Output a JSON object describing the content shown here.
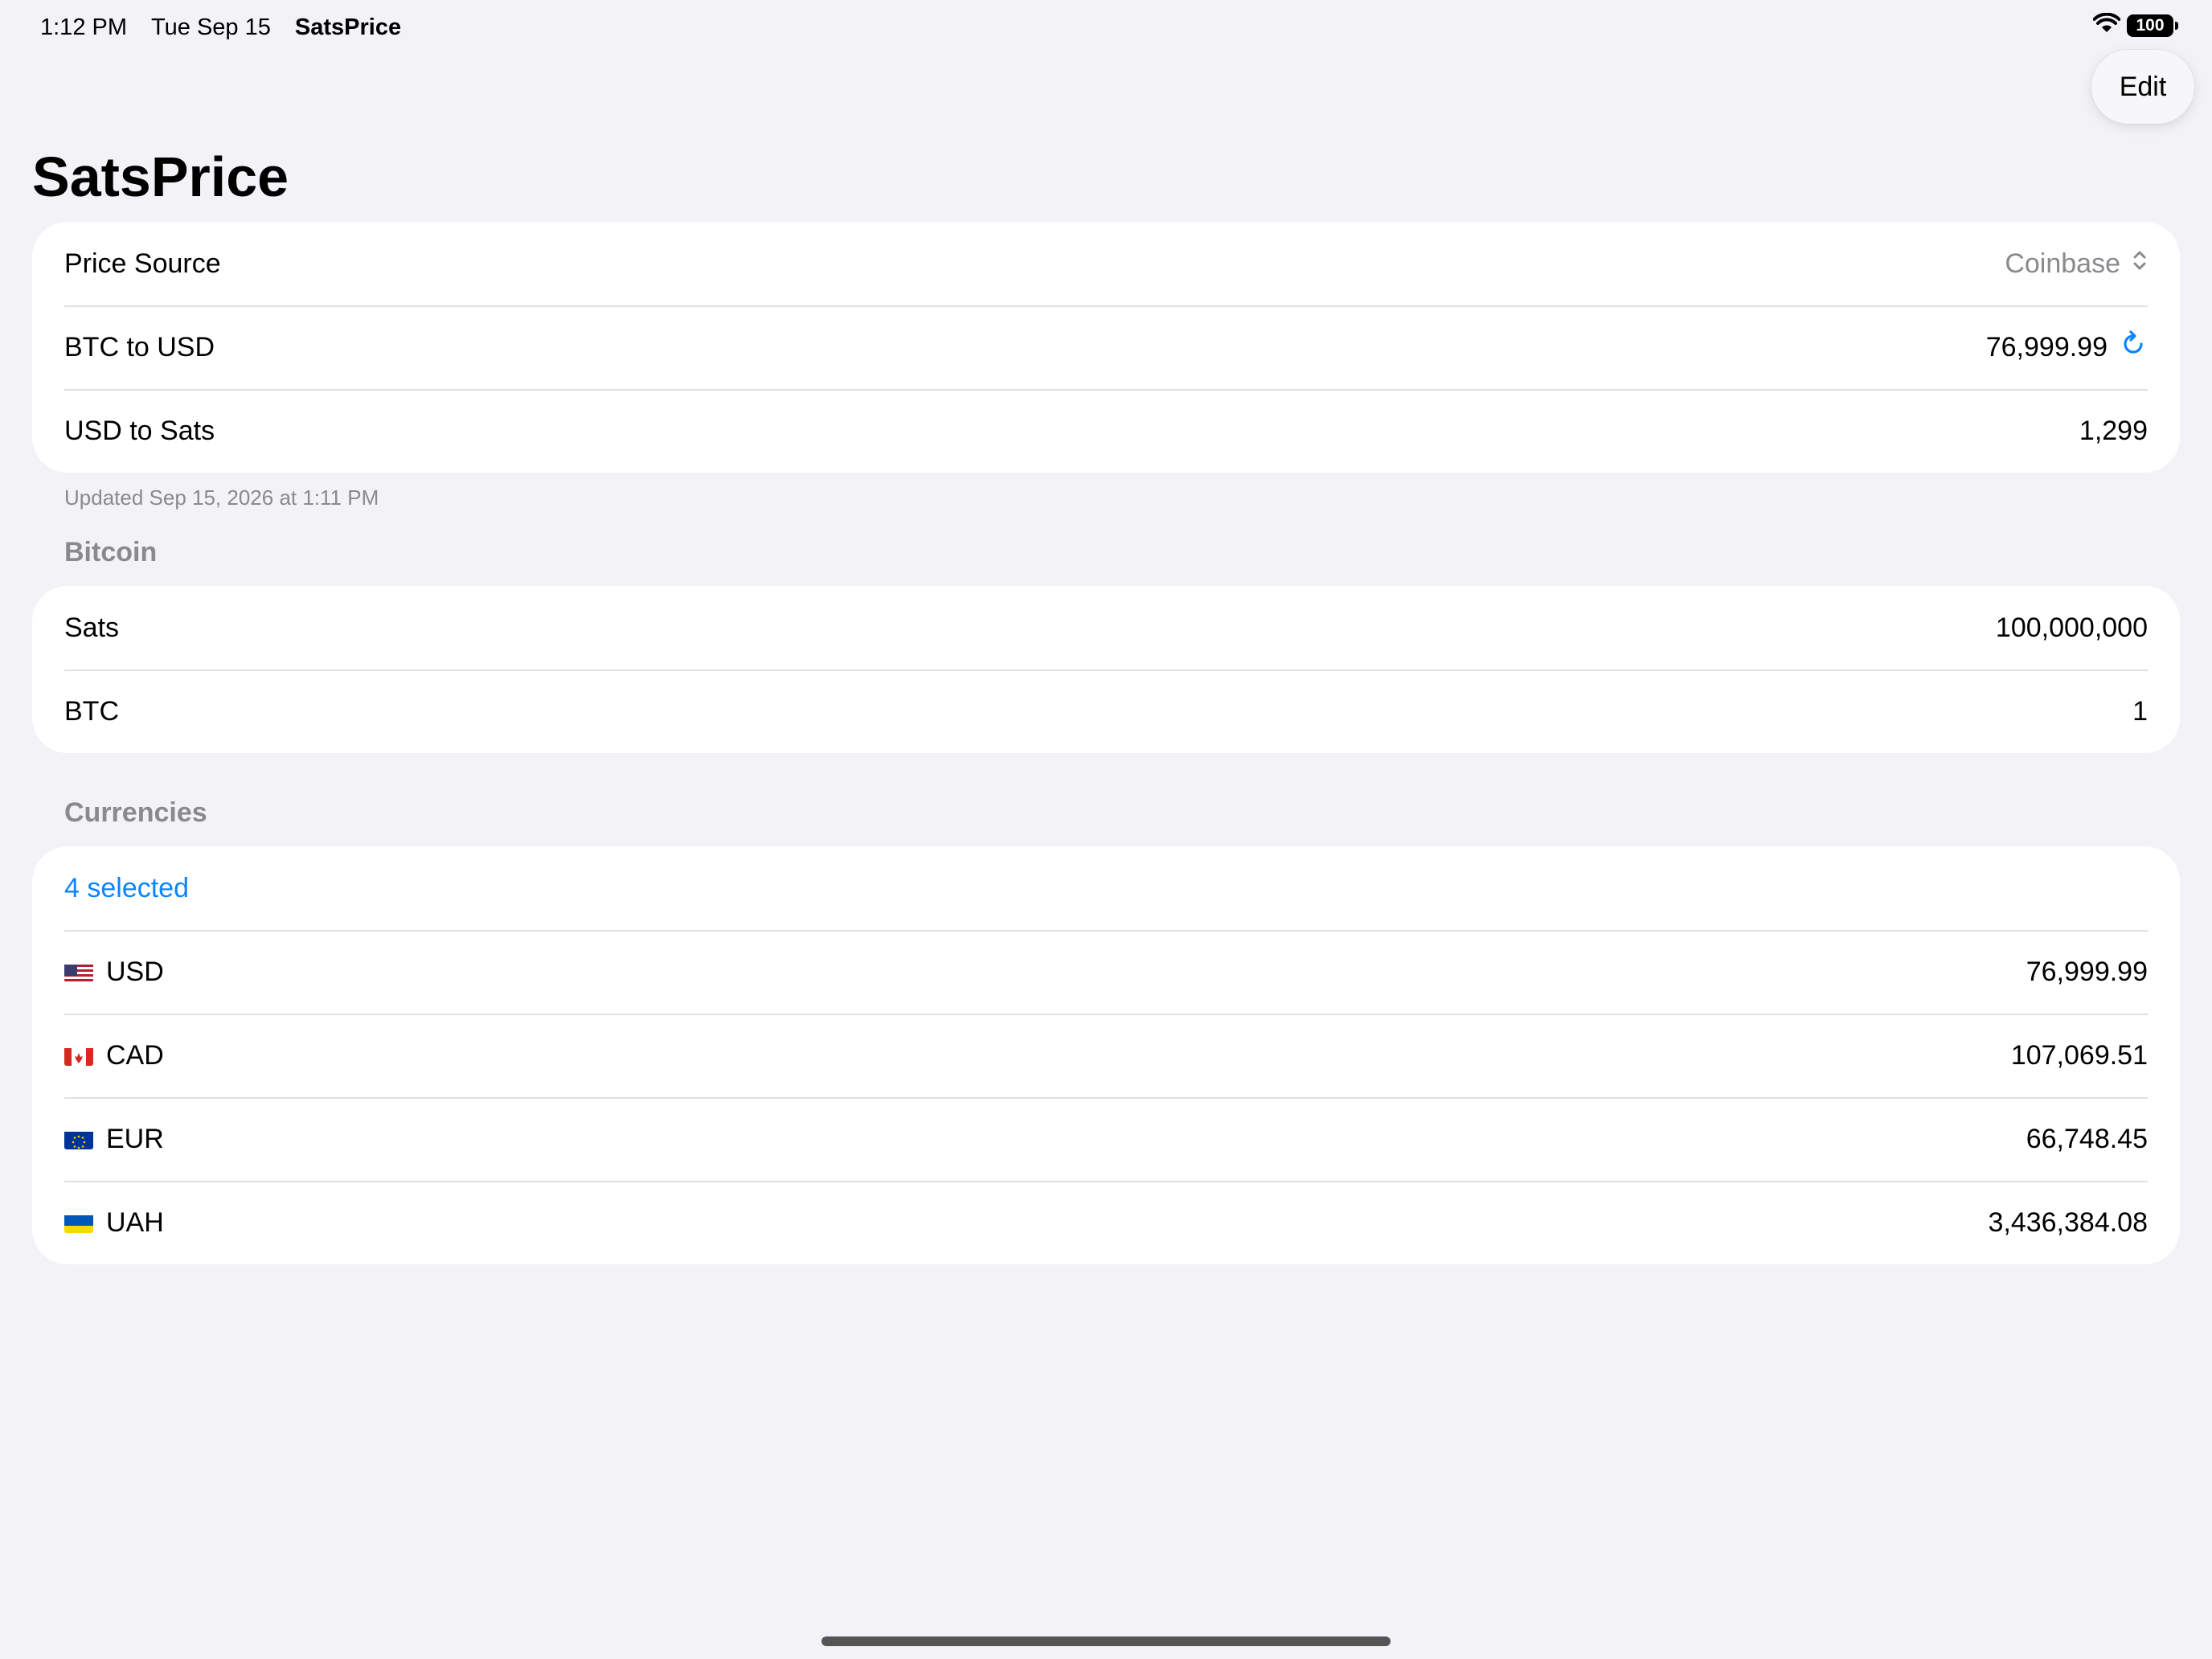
{
  "status_bar": {
    "time": "1:12 PM",
    "date": "Tue Sep 15",
    "app": "SatsPrice",
    "battery": "100"
  },
  "toolbar": {
    "edit_label": "Edit"
  },
  "page_title": "SatsPrice",
  "price_group": {
    "source_label": "Price Source",
    "source_value": "Coinbase",
    "btc_usd_label": "BTC to USD",
    "btc_usd_value": "76,999.99",
    "usd_sats_label": "USD to Sats",
    "usd_sats_value": "1,299"
  },
  "updated_note": "Updated Sep 15, 2026 at 1:11 PM",
  "bitcoin": {
    "header": "Bitcoin",
    "sats_label": "Sats",
    "sats_value": "100,000,000",
    "btc_label": "BTC",
    "btc_value": "1"
  },
  "currencies": {
    "header": "Currencies",
    "selected_label": "4 selected",
    "items": [
      {
        "code": "USD",
        "value": "76,999.99",
        "flag": "us-flag-icon"
      },
      {
        "code": "CAD",
        "value": "107,069.51",
        "flag": "ca-flag-icon"
      },
      {
        "code": "EUR",
        "value": "66,748.45",
        "flag": "eu-flag-icon"
      },
      {
        "code": "UAH",
        "value": "3,436,384.08",
        "flag": "ua-flag-icon"
      }
    ]
  },
  "colors": {
    "accent": "#0a84ff",
    "background": "#f2f2f7",
    "muted": "#8a8a8e"
  }
}
